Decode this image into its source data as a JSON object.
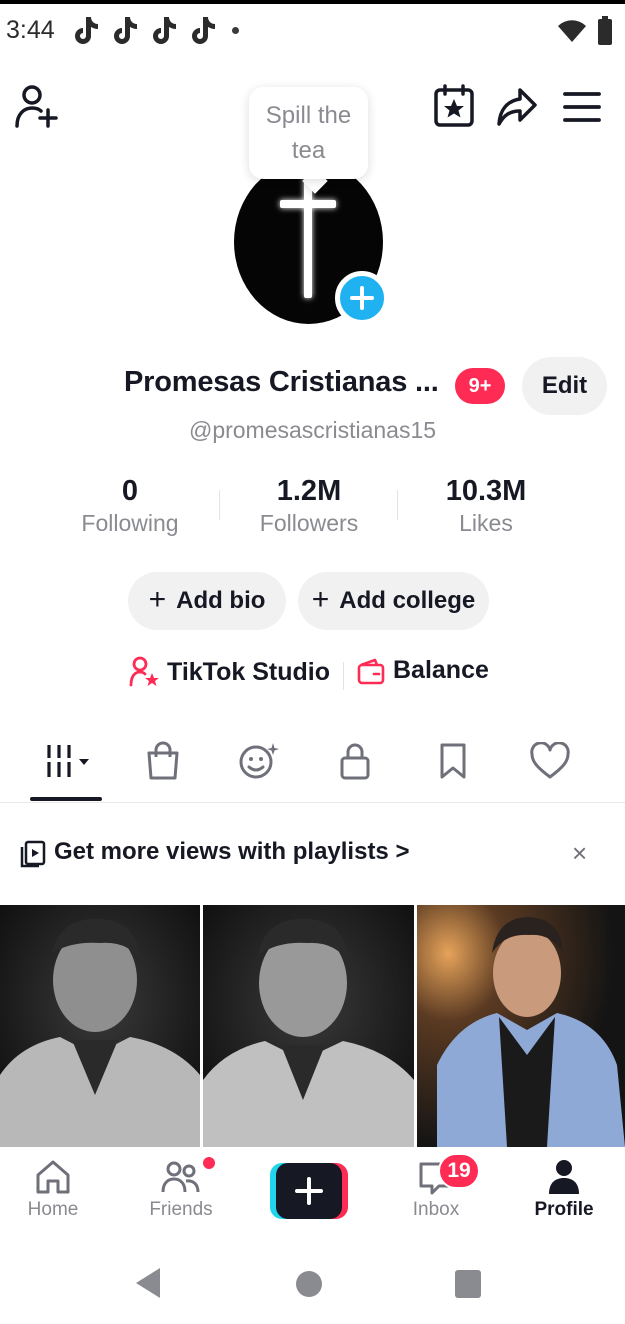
{
  "status_bar": {
    "time": "3:44",
    "notification_icons": [
      "tiktok-icon",
      "tiktok-icon",
      "tiktok-icon",
      "tiktok-icon"
    ],
    "right_icons": [
      "wifi-icon",
      "battery-icon"
    ]
  },
  "header": {
    "left_icon": "add-friend-icon",
    "right_icons": [
      "calendar-star-icon",
      "share-icon",
      "menu-icon"
    ]
  },
  "avatar": {
    "bubble_text": "Spill the tea"
  },
  "profile": {
    "name": "Promesas Cristianas ...",
    "notification_badge": "9+",
    "edit_label": "Edit",
    "handle": "@promesascristianas15"
  },
  "stats": [
    {
      "value": "0",
      "label": "Following"
    },
    {
      "value": "1.2M",
      "label": "Followers"
    },
    {
      "value": "10.3M",
      "label": "Likes"
    }
  ],
  "actions": {
    "add_bio": "Add bio",
    "add_college": "Add college",
    "plus": "+"
  },
  "links": {
    "studio": "TikTok Studio",
    "balance": "Balance"
  },
  "tabs": [
    "videos-grid-icon",
    "shop-bag-icon",
    "repost-face-icon",
    "lock-icon",
    "bookmark-icon",
    "heart-icon"
  ],
  "promo": {
    "text": "Get more views with playlists >",
    "close": "×"
  },
  "bottom_nav": {
    "items": [
      {
        "label": "Home",
        "icon": "home-icon"
      },
      {
        "label": "Friends",
        "icon": "friends-icon"
      },
      {
        "label": "",
        "icon": "create-plus-icon"
      },
      {
        "label": "Inbox",
        "icon": "inbox-icon"
      },
      {
        "label": "Profile",
        "icon": "profile-icon"
      }
    ],
    "inbox_badge": "19"
  },
  "colors": {
    "accent_red": "#fe2c55",
    "accent_blue": "#20b2f0",
    "text_primary": "#161823",
    "text_secondary": "#8a8b91"
  }
}
